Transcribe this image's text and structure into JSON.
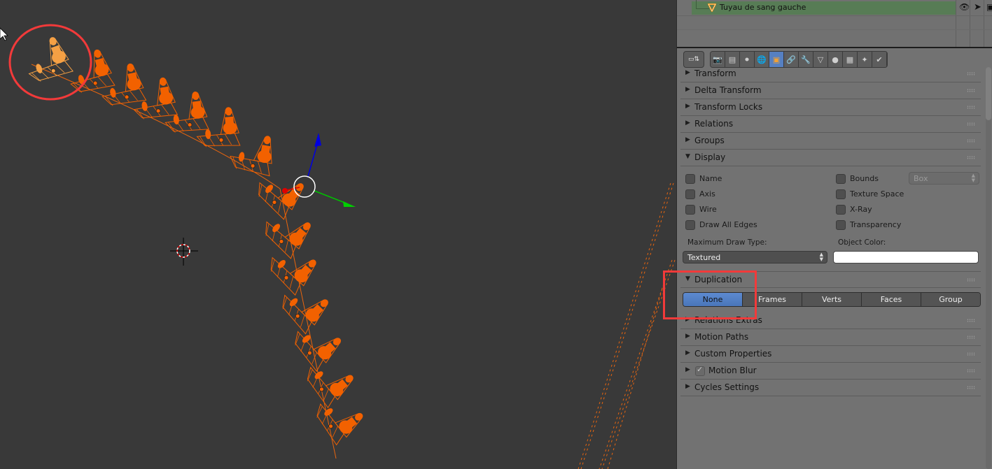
{
  "outliner": {
    "selected_object": "Tuyau de sang gauche",
    "selected_object_icon": "mesh-object-icon",
    "row_toggles": [
      "eye-icon",
      "cursor-icon",
      "render-icon"
    ]
  },
  "properties": {
    "editor_type_icon": "properties-editor-icon",
    "context_tabs": [
      {
        "name": "render",
        "icon": "camera-icon",
        "glyph": "📷",
        "active": false
      },
      {
        "name": "render-layers",
        "icon": "render-layers-icon",
        "glyph": "▤",
        "active": false
      },
      {
        "name": "scene",
        "icon": "scene-icon",
        "glyph": "⚫",
        "active": false
      },
      {
        "name": "world",
        "icon": "world-icon",
        "glyph": "🌐",
        "active": false
      },
      {
        "name": "object",
        "icon": "object-cube-icon",
        "glyph": "▣",
        "active": true
      },
      {
        "name": "constraints",
        "icon": "chain-link-icon",
        "glyph": "🔗",
        "active": false
      },
      {
        "name": "modifiers",
        "icon": "wrench-icon",
        "glyph": "🔧",
        "active": false
      },
      {
        "name": "data",
        "icon": "mesh-data-icon",
        "glyph": "▽",
        "active": false
      },
      {
        "name": "material",
        "icon": "material-sphere-icon",
        "glyph": "●",
        "active": false
      },
      {
        "name": "texture",
        "icon": "texture-checker-icon",
        "glyph": "▦",
        "active": false
      },
      {
        "name": "particles",
        "icon": "particles-icon",
        "glyph": "✦",
        "active": false
      },
      {
        "name": "physics",
        "icon": "physics-icon",
        "glyph": "✔",
        "active": false
      }
    ],
    "panels_top": [
      {
        "label": "Transform",
        "expanded": false
      },
      {
        "label": "Delta Transform",
        "expanded": false
      },
      {
        "label": "Transform Locks",
        "expanded": false
      },
      {
        "label": "Relations",
        "expanded": false
      },
      {
        "label": "Groups",
        "expanded": false
      },
      {
        "label": "Display",
        "expanded": true
      }
    ],
    "display": {
      "left_checks": [
        {
          "label": "Name",
          "checked": false
        },
        {
          "label": "Axis",
          "checked": false
        },
        {
          "label": "Wire",
          "checked": false
        },
        {
          "label": "Draw All Edges",
          "checked": false
        }
      ],
      "right_checks": [
        {
          "label": "Bounds",
          "checked": false
        },
        {
          "label": "Texture Space",
          "checked": false
        },
        {
          "label": "X-Ray",
          "checked": false
        },
        {
          "label": "Transparency",
          "checked": false
        }
      ],
      "bounds_type": "Box",
      "max_draw_type_label": "Maximum Draw Type:",
      "max_draw_type_value": "Textured",
      "object_color_label": "Object Color:",
      "object_color": "#ffffff"
    },
    "duplication": {
      "label": "Duplication",
      "expanded": true,
      "options": [
        "None",
        "Frames",
        "Verts",
        "Faces",
        "Group"
      ],
      "selected": "None"
    },
    "panels_bottom": [
      {
        "label": "Relations Extras",
        "expanded": false
      },
      {
        "label": "Motion Paths",
        "expanded": false
      },
      {
        "label": "Custom Properties",
        "expanded": false
      },
      {
        "label": "Motion Blur",
        "expanded": false,
        "checkbox": true
      },
      {
        "label": "Cycles Settings",
        "expanded": false
      }
    ]
  },
  "viewport": {
    "object_color": "#f26100",
    "selected_color": "#f5a044",
    "annotation_color": "#f23a3a",
    "gizmo_axes": {
      "x": "#e00000",
      "y": "#00d000",
      "z": "#0000e0"
    }
  }
}
